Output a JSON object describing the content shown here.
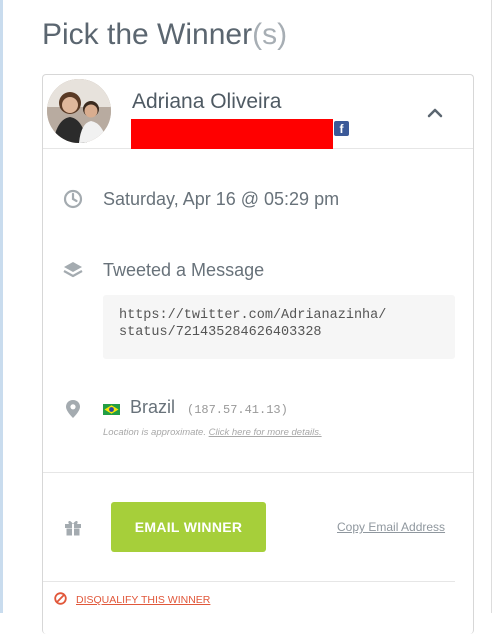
{
  "page": {
    "title": "Pick the Winner",
    "title_suffix": "(s)"
  },
  "winner": {
    "name": "Adriana Oliveira",
    "social_icon": "facebook-icon",
    "entry_date": "Saturday, Apr 16 @ 05:29 pm",
    "action": "Tweeted a Message",
    "tweet_url_line1": "https://twitter.com/Adrianazinha/",
    "tweet_url_line2": "status/721435284626403328",
    "country": "Brazil",
    "ip": "(187.57.41.13)",
    "location_note": "Location is approximate.",
    "location_link": "Click here for more details."
  },
  "actions": {
    "email_button": "EMAIL WINNER",
    "copy_email": "Copy Email Address",
    "disqualify": "DISQUALIFY THIS WINNER"
  },
  "colors": {
    "accent_green": "#a6cf3a",
    "warning_red": "#e1573a",
    "facebook_blue": "#3b5998"
  },
  "icons": {
    "collapse": "chevron-up-icon",
    "date": "clock-icon",
    "action": "layers-icon",
    "location": "map-pin-icon",
    "prize": "gift-icon",
    "disqualify": "ban-icon"
  }
}
